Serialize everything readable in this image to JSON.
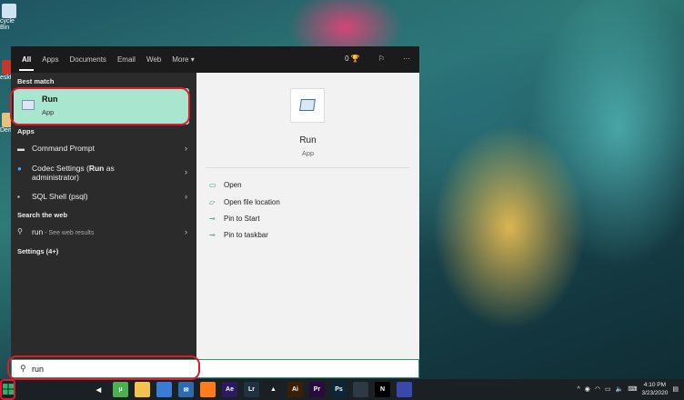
{
  "desktop": {
    "recycle_bin_label": "cycle Bin",
    "icon2_label": "eskto",
    "icon3_label": "Dem"
  },
  "search_panel": {
    "tabs": [
      "All",
      "Apps",
      "Documents",
      "Email",
      "Web",
      "More ▾"
    ],
    "points": "0",
    "sections": {
      "best_match": "Best match",
      "apps": "Apps",
      "search_web": "Search the web",
      "settings": "Settings (4+)"
    },
    "best_match_item": {
      "title": "Run",
      "subtitle": "App"
    },
    "apps": [
      {
        "label": "Command Prompt",
        "icon": "cmd-icon"
      },
      {
        "label_pre": "Codec Settings (",
        "label_bold": "Run",
        "label_post": " as",
        "label_line2": "administrator)",
        "icon": "codec-icon"
      },
      {
        "label": "SQL Shell (psql)",
        "icon": "sql-icon"
      }
    ],
    "web_result": {
      "query": "run",
      "suffix": " - See web results"
    },
    "preview": {
      "title": "Run",
      "subtitle": "App",
      "actions": [
        "Open",
        "Open file location",
        "Pin to Start",
        "Pin to taskbar"
      ]
    }
  },
  "search_box": {
    "value": "run"
  },
  "taskbar": {
    "apps": [
      {
        "name": "app-arrow-icon",
        "text": "◀",
        "color": "#1b2024"
      },
      {
        "name": "utorrent-icon",
        "text": "µ",
        "color": "#4caf50"
      },
      {
        "name": "file-explorer-icon",
        "text": "",
        "color": "#f2c14e"
      },
      {
        "name": "store-icon",
        "text": "",
        "color": "#3a7bd5"
      },
      {
        "name": "mail-icon",
        "text": "✉",
        "color": "#2b6cb0"
      },
      {
        "name": "firefox-icon",
        "text": "",
        "color": "#ff7b1c"
      },
      {
        "name": "after-effects-icon",
        "text": "Ae",
        "color": "#2b1a5e"
      },
      {
        "name": "lightroom-icon",
        "text": "Lr",
        "color": "#1d3342"
      },
      {
        "name": "vlc-icon",
        "text": "▲",
        "color": "#1b2024"
      },
      {
        "name": "illustrator-icon",
        "text": "Ai",
        "color": "#3a1e05"
      },
      {
        "name": "premiere-icon",
        "text": "Pr",
        "color": "#2a0b3d"
      },
      {
        "name": "photoshop-icon",
        "text": "Ps",
        "color": "#0a2639"
      },
      {
        "name": "resolve-icon",
        "text": "",
        "color": "#2d3a46"
      },
      {
        "name": "netflix-icon",
        "text": "N",
        "color": "#000000"
      },
      {
        "name": "app2-icon",
        "text": "",
        "color": "#3949ab"
      },
      {
        "name": "chat-icon",
        "text": "",
        "color": "#1b2024"
      },
      {
        "name": "blender-icon",
        "text": "",
        "color": "#1b2024"
      }
    ],
    "time": "4:10 PM",
    "date": "3/23/2020"
  },
  "colors": {
    "accent_green": "#a8e6cf",
    "annotation_red": "#e0192f"
  }
}
